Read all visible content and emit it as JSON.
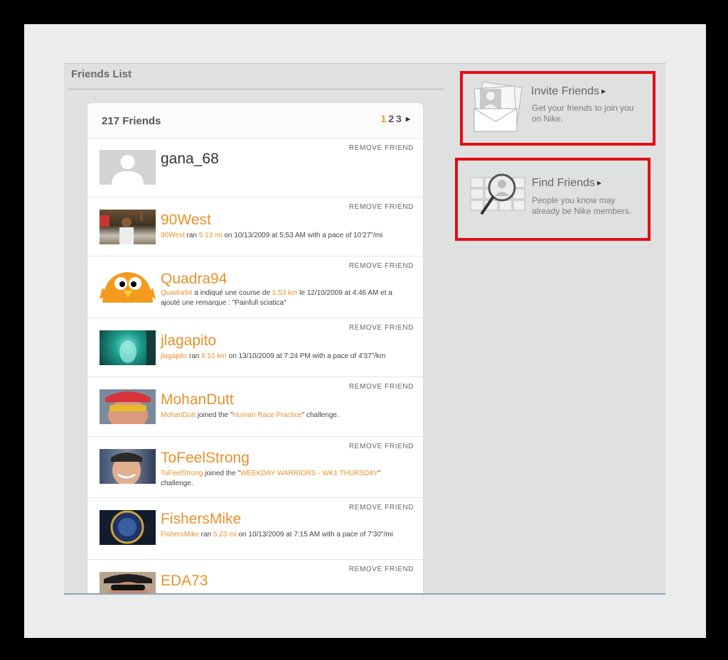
{
  "section_title": "Friends List",
  "friend_count": "217 Friends",
  "pager": {
    "current": "1",
    "pages": [
      "2",
      "3"
    ]
  },
  "remove_label": "REMOVE FRIEND",
  "friends": [
    {
      "name": "gana_68",
      "parts": []
    },
    {
      "name": "90West",
      "parts": [
        {
          "t": "90West",
          "hl": true
        },
        {
          "t": " ran "
        },
        {
          "t": "5.13 mi",
          "hl": true
        },
        {
          "t": " on 10/13/2009 at 5:53 AM with a pace of 10'27\"/mi"
        }
      ]
    },
    {
      "name": "Quadra94",
      "parts": [
        {
          "t": "Quadra94",
          "hl": true
        },
        {
          "t": " a indiqué une course de "
        },
        {
          "t": "1.53 km",
          "hl": true
        },
        {
          "t": " le 12/10/2009 at 4:46 AM et a ajouté une remarque : \"Painfull sciatica\""
        }
      ]
    },
    {
      "name": "jlagapito",
      "parts": [
        {
          "t": "jlagapito",
          "hl": true
        },
        {
          "t": " ran "
        },
        {
          "t": "6.51 km",
          "hl": true
        },
        {
          "t": " on 13/10/2009 at 7:24 PM with a pace of 4'37\"/km"
        }
      ]
    },
    {
      "name": "MohanDutt",
      "parts": [
        {
          "t": "MohanDutt",
          "hl": true
        },
        {
          "t": " joined the \""
        },
        {
          "t": "Human Race Practice",
          "hl": true
        },
        {
          "t": "\" challenge."
        }
      ]
    },
    {
      "name": "ToFeelStrong",
      "parts": [
        {
          "t": "ToFeelStrong",
          "hl": true
        },
        {
          "t": " joined the \""
        },
        {
          "t": "WEEKDAY WARRIORS - WK1 THURSDAY",
          "hl": true
        },
        {
          "t": "\" challenge."
        }
      ]
    },
    {
      "name": "FishersMike",
      "parts": [
        {
          "t": "FishersMike",
          "hl": true
        },
        {
          "t": " ran "
        },
        {
          "t": "5.23 mi",
          "hl": true
        },
        {
          "t": " on 10/13/2009 at 7:15 AM with a pace of 7'30\"/mi"
        }
      ]
    },
    {
      "name": "EDA73",
      "parts": []
    }
  ],
  "invite": {
    "title": "Invite Friends",
    "description": "Get your friends to join you on Nike."
  },
  "find": {
    "title": "Find Friends",
    "description": "People you know may already be Nike members."
  },
  "colors": {
    "accent": "#e8912b",
    "highlight_box": "#e20d14"
  }
}
